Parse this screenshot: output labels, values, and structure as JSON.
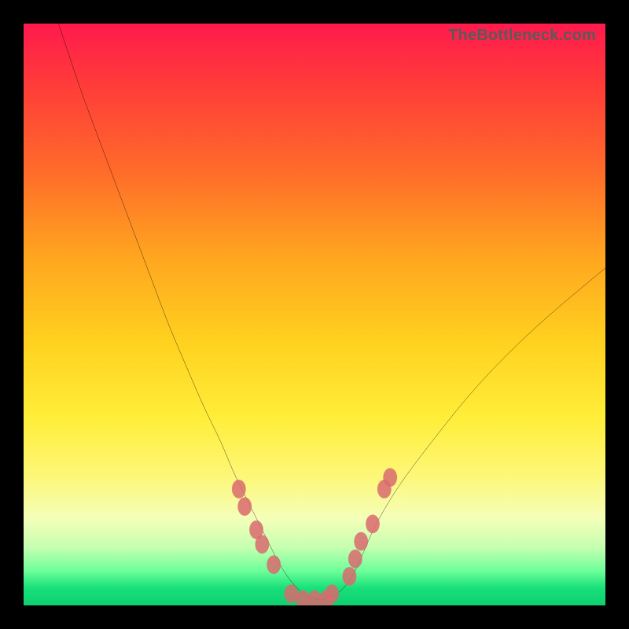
{
  "attribution": "TheBottleneck.com",
  "colors": {
    "background": "#000000",
    "gradient_top": "#ff1a4d",
    "gradient_bottom": "#0fd070",
    "curve": "#000000",
    "markers": "#d96a6f"
  },
  "chart_data": {
    "type": "line",
    "title": "",
    "xlabel": "",
    "ylabel": "",
    "xlim": [
      0,
      100
    ],
    "ylim": [
      0,
      100
    ],
    "grid": false,
    "legend": false,
    "series": [
      {
        "name": "bottleneck-curve",
        "x": [
          6,
          8,
          10,
          13,
          16,
          19,
          22,
          25,
          28,
          31,
          34,
          36,
          38,
          40,
          42,
          44,
          46,
          48,
          50,
          52,
          54,
          56,
          58,
          60,
          64,
          70,
          78,
          88,
          100
        ],
        "y": [
          100,
          94,
          88,
          80,
          72,
          64,
          56,
          48,
          41,
          34,
          28,
          23,
          19,
          15,
          11,
          7,
          4,
          2,
          1,
          1,
          2,
          4,
          8,
          13,
          20,
          28,
          38,
          48,
          58
        ]
      }
    ],
    "markers": [
      {
        "x": 37,
        "y": 20
      },
      {
        "x": 38,
        "y": 17
      },
      {
        "x": 40,
        "y": 13
      },
      {
        "x": 41,
        "y": 10.5
      },
      {
        "x": 43,
        "y": 7
      },
      {
        "x": 46,
        "y": 2
      },
      {
        "x": 48,
        "y": 1
      },
      {
        "x": 50,
        "y": 1
      },
      {
        "x": 52,
        "y": 1
      },
      {
        "x": 53,
        "y": 2
      },
      {
        "x": 56,
        "y": 5
      },
      {
        "x": 57,
        "y": 8
      },
      {
        "x": 58,
        "y": 11
      },
      {
        "x": 60,
        "y": 14
      },
      {
        "x": 62,
        "y": 20
      },
      {
        "x": 63,
        "y": 22
      }
    ]
  }
}
